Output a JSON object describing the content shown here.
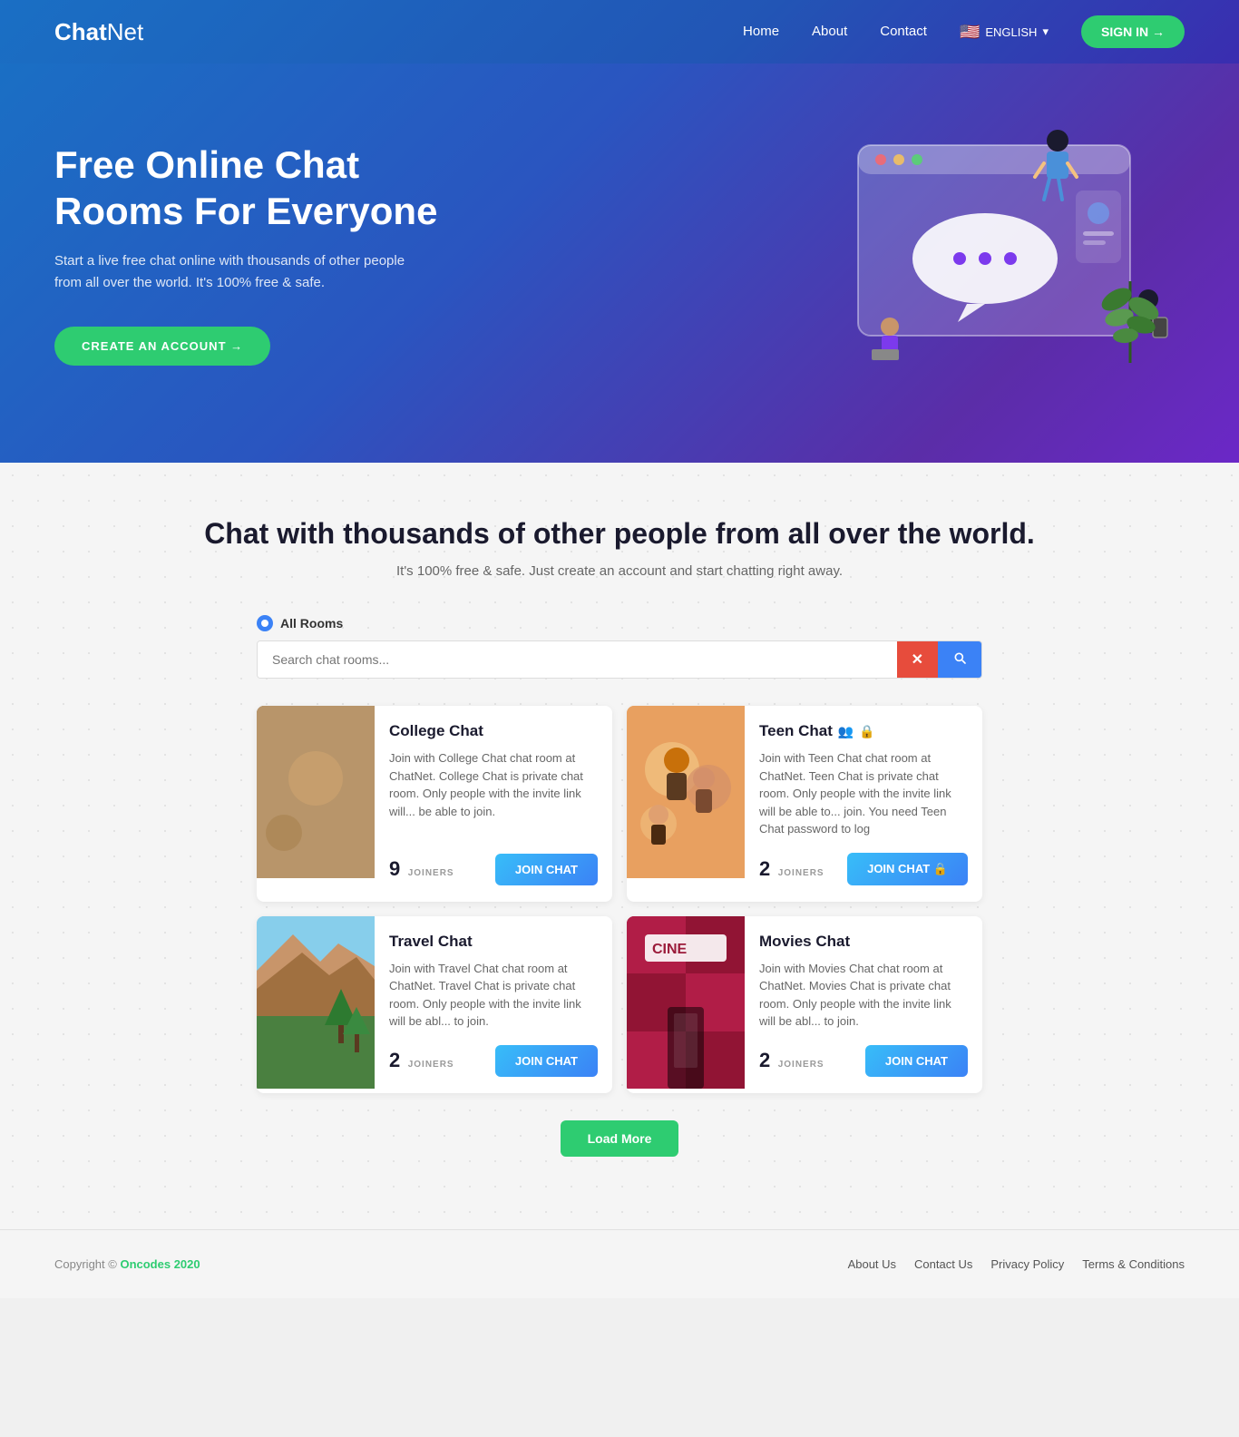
{
  "navbar": {
    "brand_bold": "Chat",
    "brand_light": "Net",
    "nav_items": [
      {
        "label": "Home",
        "id": "home"
      },
      {
        "label": "About",
        "id": "about"
      },
      {
        "label": "Contact",
        "id": "contact"
      }
    ],
    "language": "ENGLISH",
    "signin_label": "SIGN IN →"
  },
  "hero": {
    "title": "Free Online Chat Rooms For Everyone",
    "subtitle": "Start a live free chat online with thousands of other people from all over the world. It's 100% free & safe.",
    "cta_label": "CREATE AN ACCOUNT →"
  },
  "main": {
    "section_title": "Chat with thousands of other people from all over the world.",
    "section_subtitle": "It's 100% free &amp; safe. Just create an account and start chatting right away.",
    "all_rooms_label": "All Rooms",
    "search_placeholder": "Search chat rooms...",
    "search_clear": "×",
    "search_go": "🔍",
    "rooms": [
      {
        "id": "college",
        "name": "College Chat",
        "description": "Join with College Chat chat room at ChatNet. College Chat is private chat room. Only people with the invite link will... be able to join.",
        "joiners": 9,
        "joiners_label": "JOINERS",
        "join_label": "JOIN CHAT",
        "private": false,
        "img_class": "room-img-college"
      },
      {
        "id": "teen",
        "name": "Teen Chat",
        "description": "Join with Teen Chat chat room at ChatNet. Teen Chat is private chat room. Only people with the invite link will be able to... join. You need Teen Chat password to log",
        "joiners": 2,
        "joiners_label": "JOINERS",
        "join_label": "JOIN CHAT 🔒",
        "private": true,
        "img_class": "room-img-teen"
      },
      {
        "id": "travel",
        "name": "Travel Chat",
        "description": "Join with Travel Chat chat room at ChatNet. Travel Chat is private chat room. Only people with the invite link will be abl... to join.",
        "joiners": 2,
        "joiners_label": "JOINERS",
        "join_label": "JOIN CHAT",
        "private": false,
        "img_class": "room-img-travel"
      },
      {
        "id": "movies",
        "name": "Movies Chat",
        "description": "Join with Movies Chat chat room at ChatNet. Movies Chat is private chat room. Only people with the invite link will be abl... to join.",
        "joiners": 2,
        "joiners_label": "JOINERS",
        "join_label": "JOIN CHAT",
        "private": false,
        "img_class": "room-img-movies"
      }
    ],
    "load_more_label": "Load More"
  },
  "footer": {
    "copyright": "Copyright ©",
    "brand": "Oncodes 2020",
    "links": [
      "About Us",
      "Contact Us",
      "Privacy Policy",
      "Terms & Conditions"
    ]
  }
}
